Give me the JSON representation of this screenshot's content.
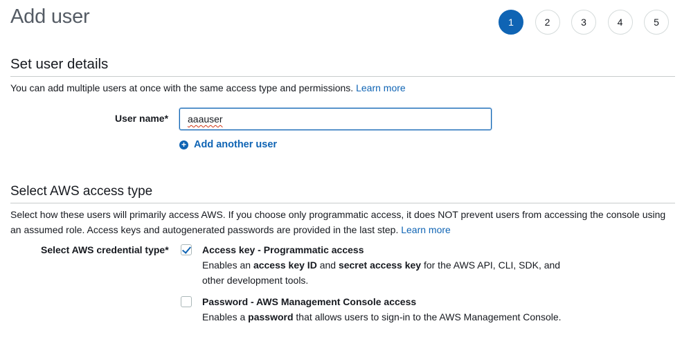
{
  "page": {
    "title": "Add user"
  },
  "steps": [
    "1",
    "2",
    "3",
    "4",
    "5"
  ],
  "details": {
    "title": "Set user details",
    "description": "You can add multiple users at once with the same access type and permissions.",
    "learn_more": "Learn more",
    "user_name_label": "User name*",
    "user_name_value": "aaauser",
    "add_another": "Add another user"
  },
  "access": {
    "title": "Select AWS access type",
    "description": "Select how these users will primarily access AWS. If you choose only programmatic access, it does NOT prevent users from accessing the console using an assumed role. Access keys and autogenerated passwords are provided in the last step.",
    "learn_more": "Learn more",
    "credential_label": "Select AWS credential type*",
    "options": [
      {
        "title": "Access key - Programmatic access",
        "checked": true,
        "desc_1": "Enables an ",
        "desc_b1": "access key ID",
        "desc_2": " and ",
        "desc_b2": "secret access key",
        "desc_3": " for the AWS API, CLI, SDK, and other development tools."
      },
      {
        "title": "Password - AWS Management Console access",
        "checked": false,
        "desc_1": "Enables a ",
        "desc_b1": "password",
        "desc_2": " that allows users to sign-in to the AWS Management Console."
      }
    ]
  },
  "colors": {
    "accent": "#0f64b4",
    "text": "#16191f",
    "muted": "#545b64",
    "divider": "#c8cccc",
    "spellcheck": "#d13212"
  },
  "icons": {
    "add_user": "plus-circle-icon",
    "checkbox_checked": "checkmark-icon"
  }
}
